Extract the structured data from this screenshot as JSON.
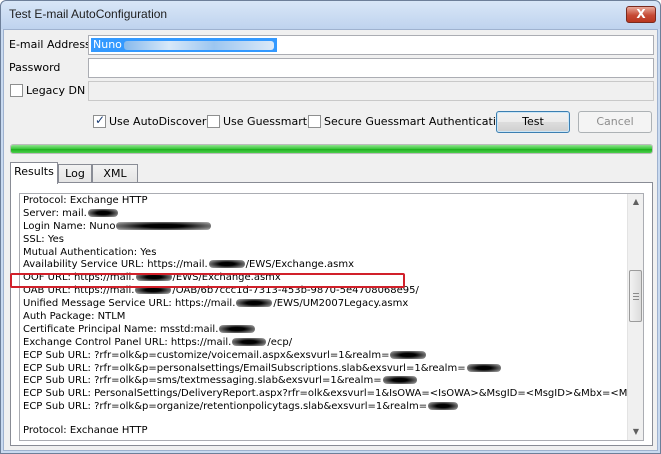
{
  "window": {
    "title": "Test E-mail AutoConfiguration",
    "close_label": "X"
  },
  "form": {
    "email_label": "E-mail Address",
    "email_value": "Nuno",
    "password_label": "Password",
    "legacy_dn_label": "Legacy DN",
    "use_autodiscover_label": "Use AutoDiscover",
    "use_autodiscover_checked": true,
    "use_guessmart_label": "Use Guessmart",
    "use_guessmart_checked": false,
    "secure_guessmart_label": "Secure Guessmart Authentication",
    "secure_guessmart_checked": false,
    "legacy_dn_checked": false,
    "test_label": "Test",
    "cancel_label": "Cancel"
  },
  "progress": {
    "value": 1.0,
    "color": "#37c737"
  },
  "tabs": [
    {
      "label": "Results",
      "active": true
    },
    {
      "label": "Log",
      "active": false
    },
    {
      "label": "XML",
      "active": false
    }
  ],
  "results": {
    "lines": [
      "Protocol: Exchange HTTP",
      "Server: mail.",
      "Login Name: Nuno",
      "SSL: Yes",
      "Mutual Authentication: Yes",
      "Availability Service URL: https://mail.",
      "OOF URL: https://mail.",
      "OAB URL: https://mail.",
      "Unified Message Service URL: https://mail.",
      "Auth Package: NTLM",
      "Certificate Principal Name: msstd:mail.",
      "Exchange Control Panel URL: https://mail.",
      "ECP Sub URL: ?rfr=olk&p=customize/voicemail.aspx&exsvurl=1&realm=",
      "ECP Sub URL: ?rfr=olk&p=personalsettings/EmailSubscriptions.slab&exsvurl=1&realm=",
      "ECP Sub URL: ?rfr=olk&p=sms/textmessaging.slab&exsvurl=1&realm=",
      "ECP Sub URL: PersonalSettings/DeliveryReport.aspx?rfr=olk&exsvurl=1&IsOWA=<IsOWA>&MsgID=<MsgID>&Mbx=<Mbx>",
      "ECP Sub URL: ?rfr=olk&p=organize/retentionpolicytags.slab&exsvurl=1&realm=",
      "Protocol: Exchange HTTP"
    ],
    "suffixes": {
      "availability": "/EWS/Exchange.asmx",
      "oof": "/EWS/Exchange.asmx",
      "oab": "/OAB/6b7ccc1d-7313-453b-9870-5e4708068e95/",
      "unified": "/EWS/UM2007Legacy.asmx",
      "ecp": "/ecp/"
    },
    "highlight_color": "#d1202a"
  }
}
